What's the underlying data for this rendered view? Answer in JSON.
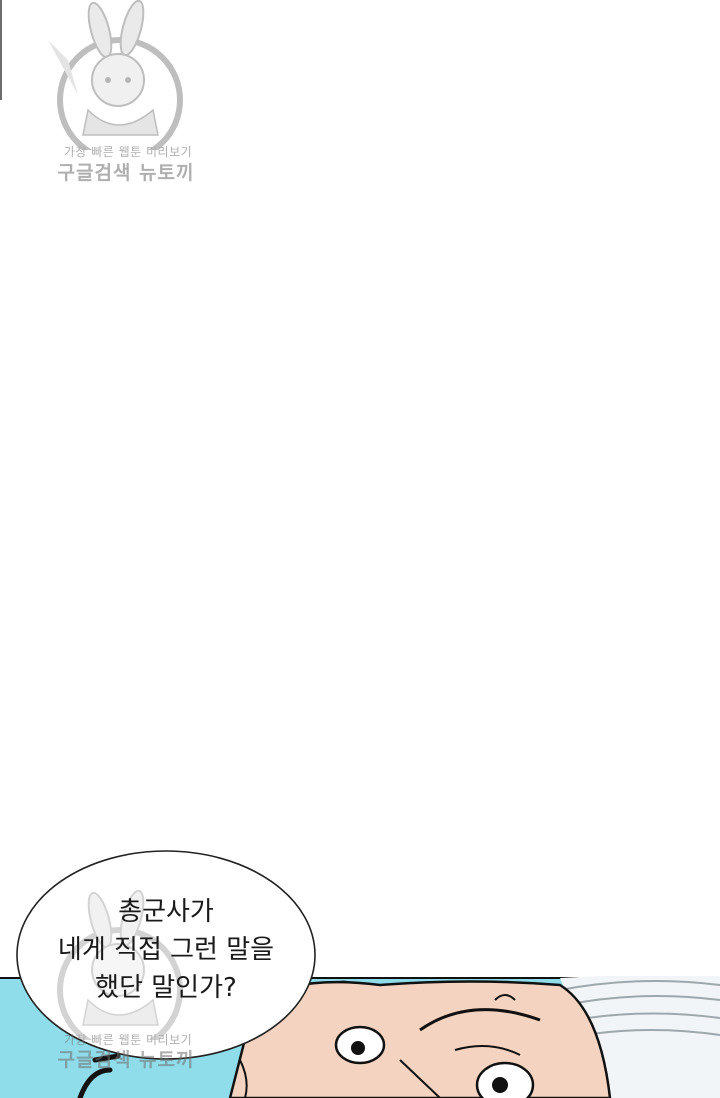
{
  "watermark": {
    "line1": "가장 빠른 웹툰 미리보기",
    "line2": "구글검색 뉴토끼",
    "icon": "bunny-mascot-icon"
  },
  "speech_bubble": {
    "lines": [
      "총군사가",
      "네게 직접 그런 말을",
      "했단 말인가?"
    ]
  },
  "colors": {
    "background": "#ffffff",
    "sky": "#8fdcea",
    "skin": "#f2d2c0",
    "hair": "#e8eef2",
    "outline": "#111111"
  }
}
